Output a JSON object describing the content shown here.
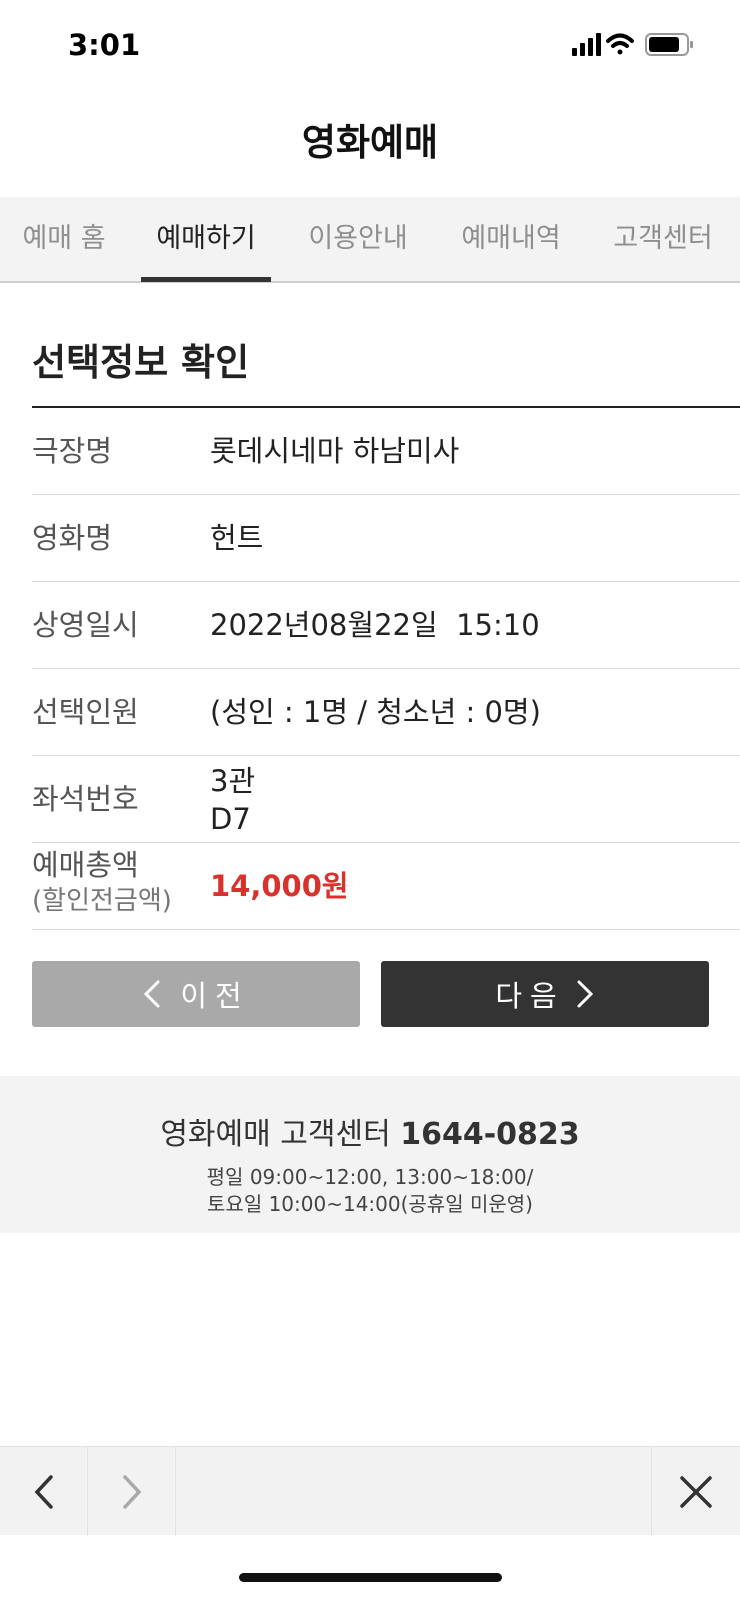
{
  "status_bar": {
    "time": "3:01"
  },
  "header": {
    "title": "영화예매"
  },
  "tabs": [
    {
      "label": "예매 홈"
    },
    {
      "label": "예매하기"
    },
    {
      "label": "이용안내"
    },
    {
      "label": "예매내역"
    },
    {
      "label": "고객센터"
    }
  ],
  "section": {
    "title": "선택정보 확인"
  },
  "info": {
    "theater": {
      "label": "극장명",
      "value": "롯데시네마 하남미사"
    },
    "movie": {
      "label": "영화명",
      "value": "헌트"
    },
    "showtime": {
      "label": "상영일시",
      "value": "2022년08월22일  15:10"
    },
    "people": {
      "label": "선택인원",
      "value": "(성인 : 1명 / 청소년 : 0명)"
    },
    "seat": {
      "label": "좌석번호",
      "hall": "3관",
      "seat": "D7"
    },
    "total": {
      "label": "예매총액",
      "sublabel": "(할인전금액)",
      "value": "14,000원"
    }
  },
  "buttons": {
    "prev": "이전",
    "next": "다음"
  },
  "footer": {
    "title": "영화예매 고객센터",
    "phone": "1644-0823",
    "hours_weekday": "평일 09:00~12:00, 13:00~18:00/",
    "hours_saturday": "토요일 10:00~14:00(공휴일 미운영)"
  },
  "colors": {
    "accent_price": "#d7322c",
    "next_button": "#333333",
    "prev_button": "#a9a9a9"
  },
  "icons": [
    "signal-icon",
    "wifi-icon",
    "battery-icon",
    "chevron-left-icon",
    "chevron-right-icon",
    "close-icon"
  ]
}
